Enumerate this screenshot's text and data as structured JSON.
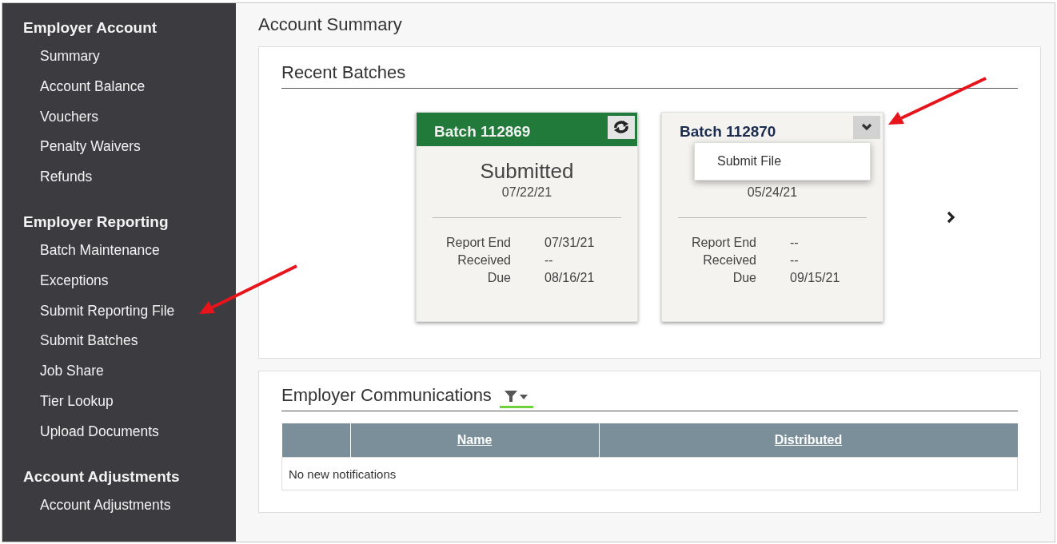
{
  "sidebar": {
    "groups": [
      {
        "heading": "Employer Account",
        "items": [
          "Summary",
          "Account Balance",
          "Vouchers",
          "Penalty Waivers",
          "Refunds"
        ]
      },
      {
        "heading": "Employer Reporting",
        "items": [
          "Batch Maintenance",
          "Exceptions",
          "Submit Reporting File",
          "Submit Batches",
          "Job Share",
          "Tier Lookup",
          "Upload Documents"
        ]
      },
      {
        "heading": "Account Adjustments",
        "items": [
          "Account Adjustments"
        ]
      }
    ]
  },
  "page_title": "Account Summary",
  "recent_batches": {
    "title": "Recent Batches",
    "batches": [
      {
        "title": "Batch 112869",
        "kind": "submitted",
        "status": "Submitted",
        "date": "07/22/21",
        "menu_open": false,
        "fields": [
          {
            "label": "Report End",
            "value": "07/31/21"
          },
          {
            "label": "Received",
            "value": "--"
          },
          {
            "label": "Due",
            "value": "08/16/21"
          }
        ]
      },
      {
        "title": "Batch 112870",
        "kind": "open",
        "date": "05/24/21",
        "menu_open": true,
        "menu_items": [
          "Submit File"
        ],
        "fields": [
          {
            "label": "Report End",
            "value": "--"
          },
          {
            "label": "Received",
            "value": "--"
          },
          {
            "label": "Due",
            "value": "09/15/21"
          }
        ]
      }
    ]
  },
  "communications": {
    "title": "Employer Communications",
    "columns": [
      "Name",
      "Distributed"
    ],
    "empty_message": "No new notifications"
  }
}
